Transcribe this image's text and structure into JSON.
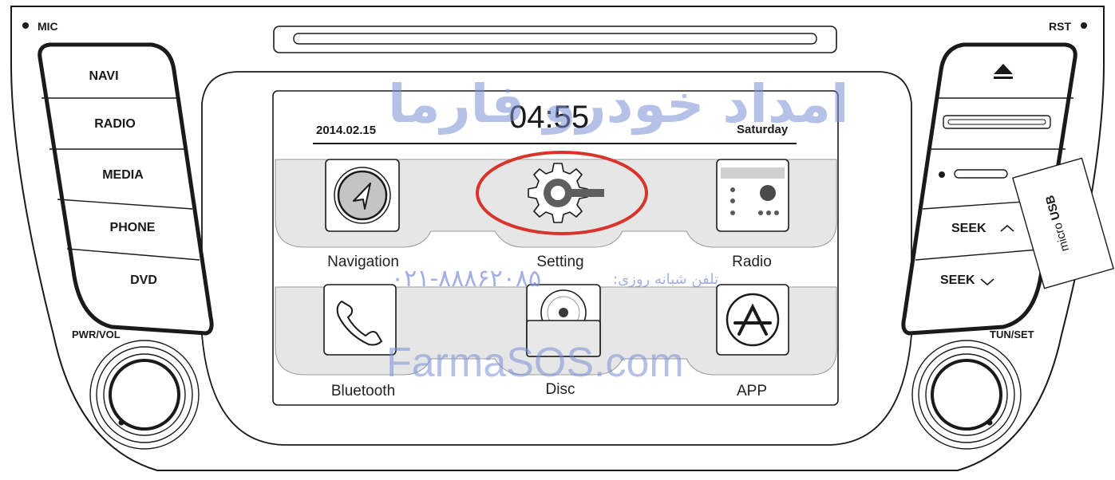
{
  "device": {
    "mic_label": "MIC",
    "rst_label": "RST",
    "pwr_vol_label": "PWR/VOL",
    "tun_set_label": "TUN/SET",
    "micro_usb": {
      "prefix": "micro",
      "main": "USB"
    }
  },
  "left_buttons": [
    {
      "label": "NAVI"
    },
    {
      "label": "RADIO"
    },
    {
      "label": "MEDIA"
    },
    {
      "label": "PHONE"
    },
    {
      "label": "DVD"
    }
  ],
  "right_buttons": {
    "eject_icon": "eject-icon",
    "slot_icon": "card-slot-icon",
    "usb_icon": "usb-slot-icon",
    "seek_up": "SEEK",
    "seek_down": "SEEK"
  },
  "screen": {
    "date": "2014.02.15",
    "time": "04:55",
    "day": "Saturday",
    "apps": [
      {
        "label": "Navigation",
        "icon": "navigation-icon"
      },
      {
        "label": "Setting",
        "icon": "gear-icon",
        "highlighted": true
      },
      {
        "label": "Radio",
        "icon": "radio-icon"
      },
      {
        "label": "Bluetooth",
        "icon": "phone-icon"
      },
      {
        "label": "Disc",
        "icon": "disc-icon"
      },
      {
        "label": "APP",
        "icon": "app-store-icon"
      }
    ]
  },
  "watermark": {
    "persian_brand": "امداد خودرو فارما",
    "phone_caption": "تلفن شبانه روزی:",
    "phone_number": "۰۲۱-۸۸۸۶۲۰۸۵",
    "site": "FarmaSOS.com",
    "color": "#7b8fd6"
  },
  "colors": {
    "highlight": "#d9342b",
    "outline": "#1a1a1a",
    "panel": "#e4e4e4"
  }
}
